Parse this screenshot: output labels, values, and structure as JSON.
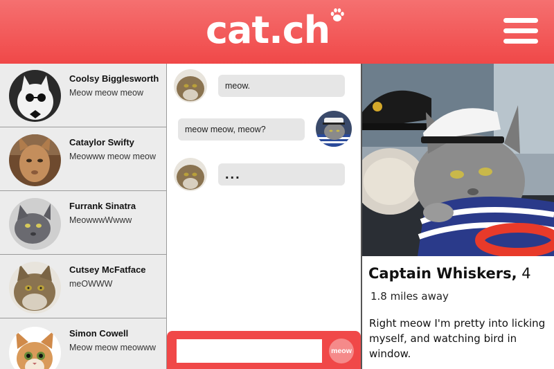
{
  "app": {
    "logo": "cat.ch"
  },
  "contacts": [
    {
      "name": "Coolsy Bigglesworth",
      "message": "Meow meow meow"
    },
    {
      "name": "Cataylor Swifty",
      "message": "Meowww meow meow"
    },
    {
      "name": "Furrank Sinatra",
      "message": "MeowwwWwww"
    },
    {
      "name": "Cutsey McFatface",
      "message": "meOWWW"
    },
    {
      "name": "Simon Cowell",
      "message": "Meow meow meowww"
    }
  ],
  "chat": {
    "messages": [
      {
        "sender": "them",
        "text": "meow."
      },
      {
        "sender": "me",
        "text": "meow meow, meow?"
      },
      {
        "sender": "them",
        "text": "..."
      }
    ],
    "input_value": "",
    "send_label": "meow"
  },
  "profile": {
    "name": "Captain Whiskers,",
    "age": "4",
    "distance": "1.8 miles away",
    "bio": "Right meow I'm pretty into licking myself, and watching bird in window."
  },
  "colors": {
    "brand": "#f04848",
    "send_button": "#f58a8a",
    "panel_bg": "#ececec",
    "bubble_bg": "#e6e6e6"
  }
}
